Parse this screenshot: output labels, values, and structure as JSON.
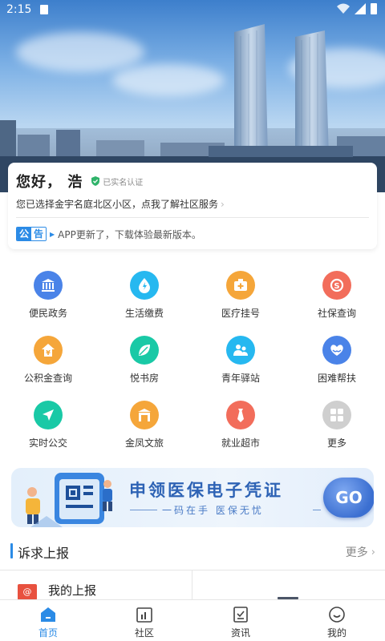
{
  "status_bar": {
    "time": "2:15"
  },
  "greeting": {
    "hello": "您好， 浩",
    "verified": "已实名认证",
    "community_text": "您已选择金宇名庭北区小区，点我了解社区服务",
    "chevron": "›"
  },
  "notice": {
    "tag_1": "公",
    "tag_2": "告",
    "text": "APP更新了，下载体验最新版本。"
  },
  "services": [
    {
      "label": "便民政务",
      "color": "#4a83e8",
      "icon": "government-building-icon"
    },
    {
      "label": "生活缴费",
      "color": "#26b8f0",
      "icon": "utility-drop-icon"
    },
    {
      "label": "医疗挂号",
      "color": "#f5a63a",
      "icon": "medical-kit-icon"
    },
    {
      "label": "社保查询",
      "color": "#f26d5b",
      "icon": "social-security-icon"
    },
    {
      "label": "公积金查询",
      "color": "#f5a63a",
      "icon": "housing-fund-icon"
    },
    {
      "label": "悦书房",
      "color": "#19c9a6",
      "icon": "leaf-book-icon"
    },
    {
      "label": "青年驿站",
      "color": "#26b8f0",
      "icon": "youth-people-icon"
    },
    {
      "label": "困难帮扶",
      "color": "#4a83e8",
      "icon": "heart-hands-icon"
    },
    {
      "label": "实时公交",
      "color": "#19c9a6",
      "icon": "navigation-arrow-icon"
    },
    {
      "label": "金凤文旅",
      "color": "#f5a63a",
      "icon": "tourism-gate-icon"
    },
    {
      "label": "就业超市",
      "color": "#f26d5b",
      "icon": "tie-icon"
    },
    {
      "label": "更多",
      "color": "#cfcfcf",
      "icon": "grid-more-icon"
    }
  ],
  "promo": {
    "title": "申领医保电子凭证",
    "subtitle": "一码在手 医保无忧",
    "go": "GO"
  },
  "section": {
    "title": "诉求上报",
    "more": "更多",
    "chevron": "›"
  },
  "report": {
    "my_report": "我的上报",
    "my_report_icon": "@"
  },
  "tabs": [
    {
      "label": "首页",
      "icon": "home-icon",
      "active": true
    },
    {
      "label": "社区",
      "icon": "community-icon",
      "active": false
    },
    {
      "label": "资讯",
      "icon": "news-icon",
      "active": false
    },
    {
      "label": "我的",
      "icon": "profile-icon",
      "active": false
    }
  ],
  "colors": {
    "accent": "#2b8be6",
    "verified_green": "#2fb36a"
  }
}
